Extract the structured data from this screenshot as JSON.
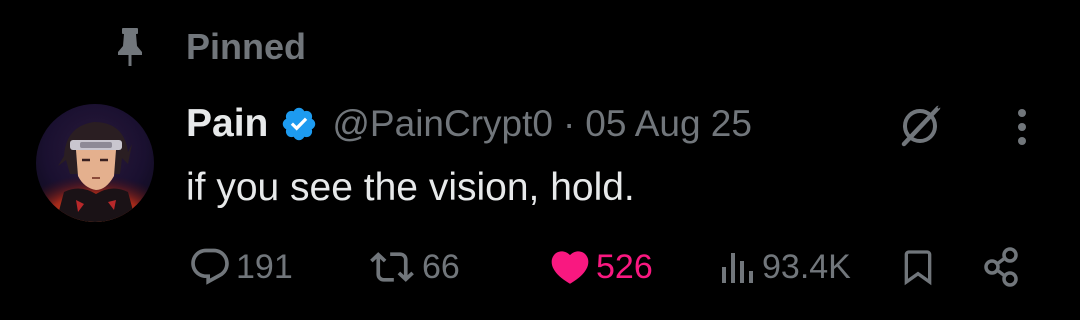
{
  "pinned": {
    "label": "Pinned",
    "icon": "pin-icon"
  },
  "author": {
    "display_name": "Pain",
    "handle": "@PainCrypt0",
    "verified_icon": "verified-badge-icon",
    "avatar": "avatar"
  },
  "meta": {
    "separator": "·",
    "date": "05 Aug 25"
  },
  "tweet": {
    "text": "if you see the vision, hold."
  },
  "actions": {
    "replies": {
      "icon": "reply-icon",
      "count": "191"
    },
    "reposts": {
      "icon": "repost-icon",
      "count": "66"
    },
    "likes": {
      "icon": "heart-filled-icon",
      "count": "526"
    },
    "views": {
      "icon": "views-chart-icon",
      "count": "93.4K"
    },
    "bookmark": {
      "icon": "bookmark-icon"
    },
    "share": {
      "icon": "share-icon"
    }
  },
  "colors": {
    "background": "#000000",
    "primary_text": "#e7e9ea",
    "secondary_text": "#71767b",
    "verified_blue": "#1d9bf0",
    "like_pink": "#f91880"
  }
}
